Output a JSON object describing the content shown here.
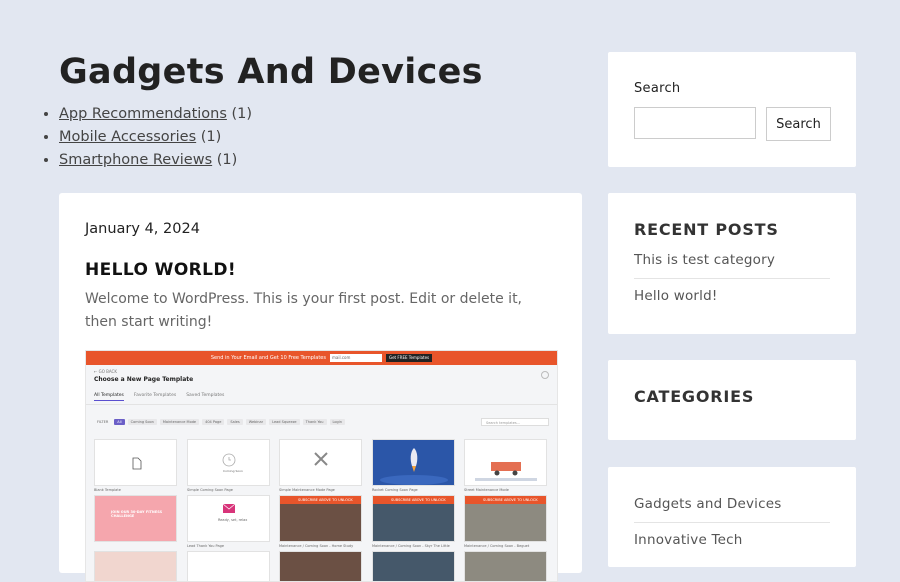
{
  "archive": {
    "title": "Gadgets And Devices",
    "categories": [
      {
        "label": "App Recommendations",
        "count": "(1)"
      },
      {
        "label": "Mobile Accessories",
        "count": "(1)"
      },
      {
        "label": "Smartphone Reviews",
        "count": "(1)"
      }
    ]
  },
  "post": {
    "date": "January 4, 2024",
    "title": "HELLO WORLD!",
    "excerpt": "Welcome to WordPress. This is your first post. Edit or delete it, then start writing!",
    "image": {
      "promo_text": "Send in Your Email and Get 10 Free Templates",
      "promo_field": "mail.com",
      "promo_button": "Get FREE Templates",
      "back": "← GO BACK",
      "modal_title": "Choose a New Page Template",
      "tabs": [
        "All Templates",
        "Favorite Templates",
        "Saved Templates"
      ],
      "filters": [
        "FILTER",
        "All",
        "Coming Soon",
        "Maintenance Mode",
        "404 Page",
        "Sales",
        "Webinar",
        "Lead Squeeze",
        "Thank You",
        "Login"
      ],
      "search_placeholder": "Search templates...",
      "thumbs": [
        "Blank Template",
        "Simple Coming Soon Page",
        "Simple Maintenance Mode Page",
        "Rocket Coming Soon Page",
        "Street Maintenance Mode",
        "Lead Thank You Page",
        "Maintenance / Coming Soon - Home Study",
        "Maintenance / Coming Soon - Skyr The Little",
        "Maintenance / Coming Soon - Beguet"
      ],
      "thumb_texts": {
        "coming_soon": "Coming Soon",
        "pink_banner": "JOIN OUR 30-DAY FITNESS CHALLENGE",
        "orange_banner": "SUBSCRIBE ABOVE TO UNLOCK",
        "ready": "Ready, set, relax"
      }
    }
  },
  "sidebar": {
    "search": {
      "label": "Search",
      "placeholder": "",
      "button": "Search"
    },
    "recent_posts": {
      "title": "RECENT POSTS",
      "items": [
        "This is test category",
        "Hello world!"
      ]
    },
    "categories": {
      "title": "CATEGORIES",
      "items": [
        "Gadgets and Devices",
        "Innovative Tech"
      ]
    }
  },
  "colors": {
    "background": "#e2e7f1",
    "card": "#ffffff",
    "accent": "#e8552b"
  }
}
